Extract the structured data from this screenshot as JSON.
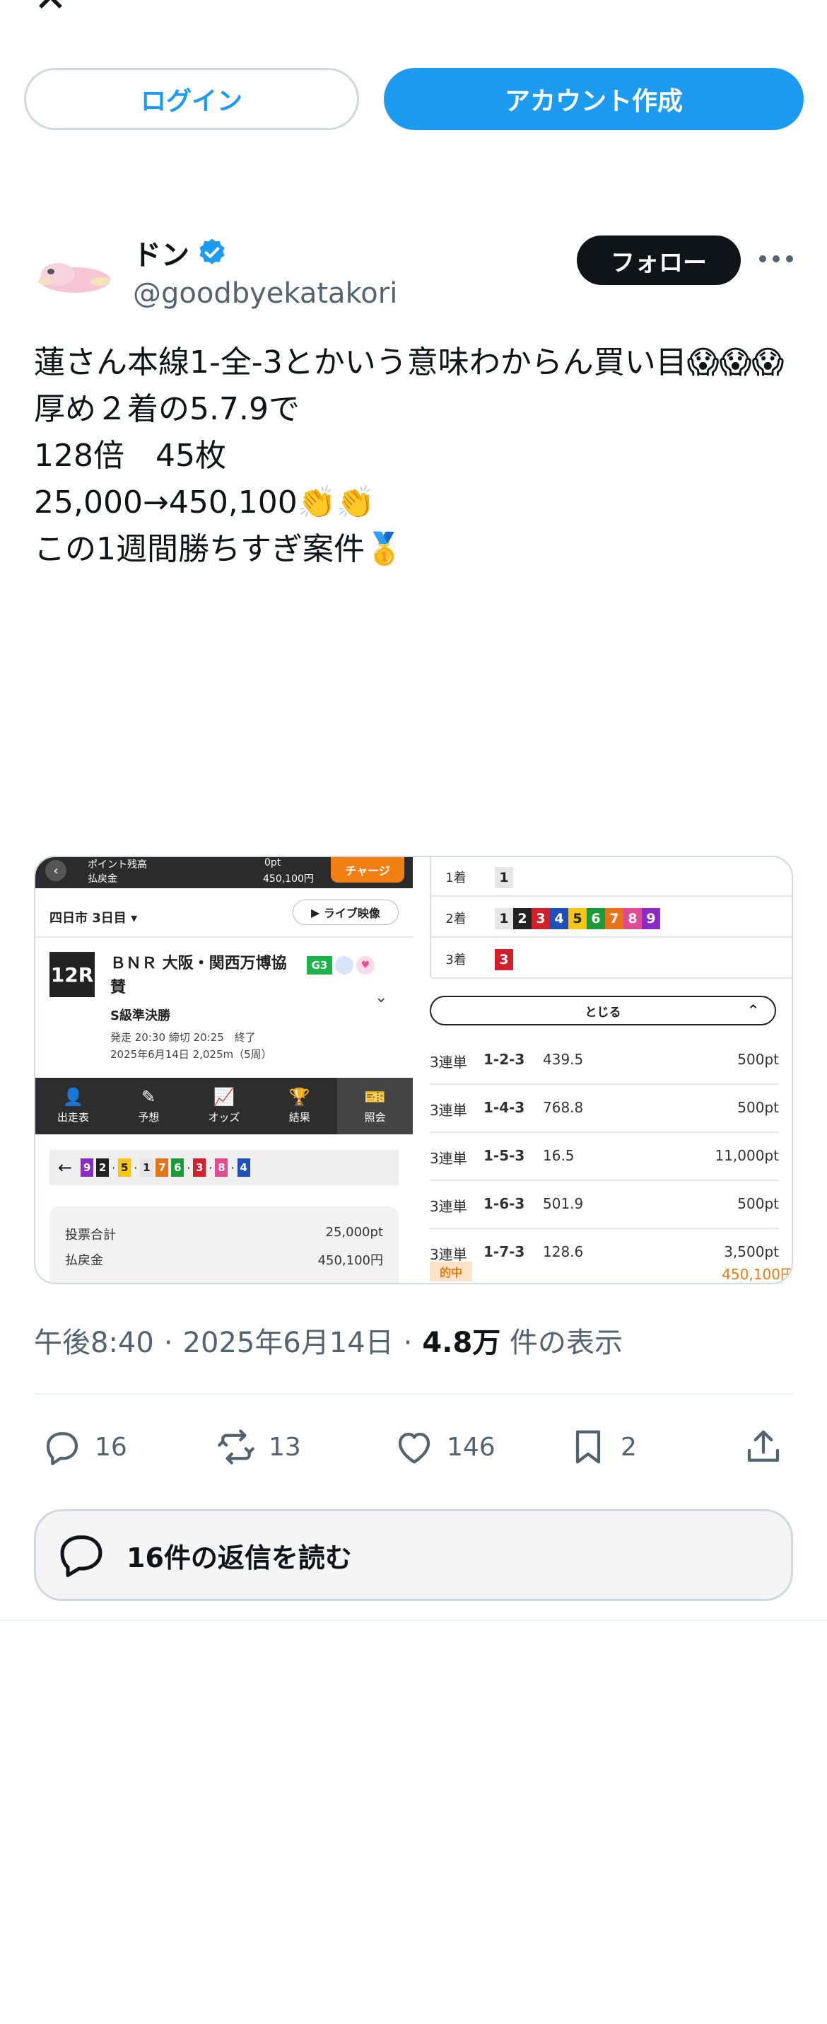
{
  "header": {
    "close_icon": "x-close",
    "login_label": "ログイン",
    "signup_label": "アカウント作成"
  },
  "user": {
    "name": "ドン",
    "handle": "@goodbyekatakori",
    "verified": true,
    "follow_label": "フォロー"
  },
  "tweet": {
    "lines": [
      "蓮さん本線1-全-3とかいう意味わからん買い目😱😱😱",
      "",
      "厚め２着の5.7.9で",
      "",
      "128倍　45枚",
      "",
      "25,000→450,100👏👏",
      "",
      "この1週間勝ちすぎ案件🥇"
    ]
  },
  "media": {
    "left": {
      "top_bar": {
        "line1": "ポイント残高",
        "line2": "払戻金",
        "pt": "0pt",
        "amount": "450,100円",
        "charge": "チャージ"
      },
      "venue": "四日市 3日目",
      "live": "ライブ映像",
      "race_no": "12R",
      "race_name": "ＢＮＲ 大阪・関西万博協賛",
      "grade_badge": "G3",
      "race_grade": "S級準決勝",
      "race_time": "発走 20:30 締切 20:25　終了",
      "race_date": "2025年6月14日 2,025m（5周）",
      "tabs": [
        {
          "label": "出走表",
          "icon": "👤"
        },
        {
          "label": "予想",
          "icon": "✎"
        },
        {
          "label": "オッズ",
          "icon": "📈"
        },
        {
          "label": "結果",
          "icon": "🏆"
        },
        {
          "label": "照会",
          "icon": "🎫"
        }
      ],
      "picks": [
        "9",
        "2",
        "5",
        "1",
        "7",
        "6",
        "3",
        "8",
        "4"
      ],
      "totals": {
        "label1": "投票合計",
        "value1": "25,000pt",
        "label2": "払戻金",
        "value2": "450,100円"
      }
    },
    "right": {
      "rows": [
        {
          "label": "1着",
          "nums": [
            "1"
          ]
        },
        {
          "label": "2着",
          "nums": [
            "1",
            "2",
            "3",
            "4",
            "5",
            "6",
            "7",
            "8",
            "9"
          ]
        },
        {
          "label": "3着",
          "nums": [
            "3"
          ]
        }
      ],
      "close_label": "とじる",
      "results": [
        {
          "kind": "3連単",
          "combo": "1-2-3",
          "odds": "439.5",
          "amount": "500pt"
        },
        {
          "kind": "3連単",
          "combo": "1-4-3",
          "odds": "768.8",
          "amount": "500pt"
        },
        {
          "kind": "3連単",
          "combo": "1-5-3",
          "odds": "16.5",
          "amount": "11,000pt"
        },
        {
          "kind": "3連単",
          "combo": "1-6-3",
          "odds": "501.9",
          "amount": "500pt"
        },
        {
          "kind": "3連単",
          "combo": "1-7-3",
          "odds": "128.6",
          "amount": "3,500pt"
        }
      ],
      "hit_label": "的中",
      "hit_amount": "450,100円"
    },
    "num_colors": {
      "1": "#e6e6e6",
      "2": "#222222",
      "3": "#d0202c",
      "4": "#1f4fb8",
      "5": "#f5c518",
      "6": "#1c9a3a",
      "7": "#e8741a",
      "8": "#e24a93",
      "9": "#8a2bc2"
    }
  },
  "meta": {
    "time": "午後8:40",
    "date": "2025年6月14日",
    "views": "4.8万",
    "views_suffix": "件の表示",
    "sep": "·"
  },
  "actions": {
    "replies": "16",
    "retweets": "13",
    "likes": "146",
    "bookmarks": "2"
  },
  "read_replies": "16件の返信を読む",
  "colors": {
    "accent": "#1d9bf0",
    "text": "#0f1419",
    "muted": "#536471",
    "border": "#cfd9de"
  }
}
